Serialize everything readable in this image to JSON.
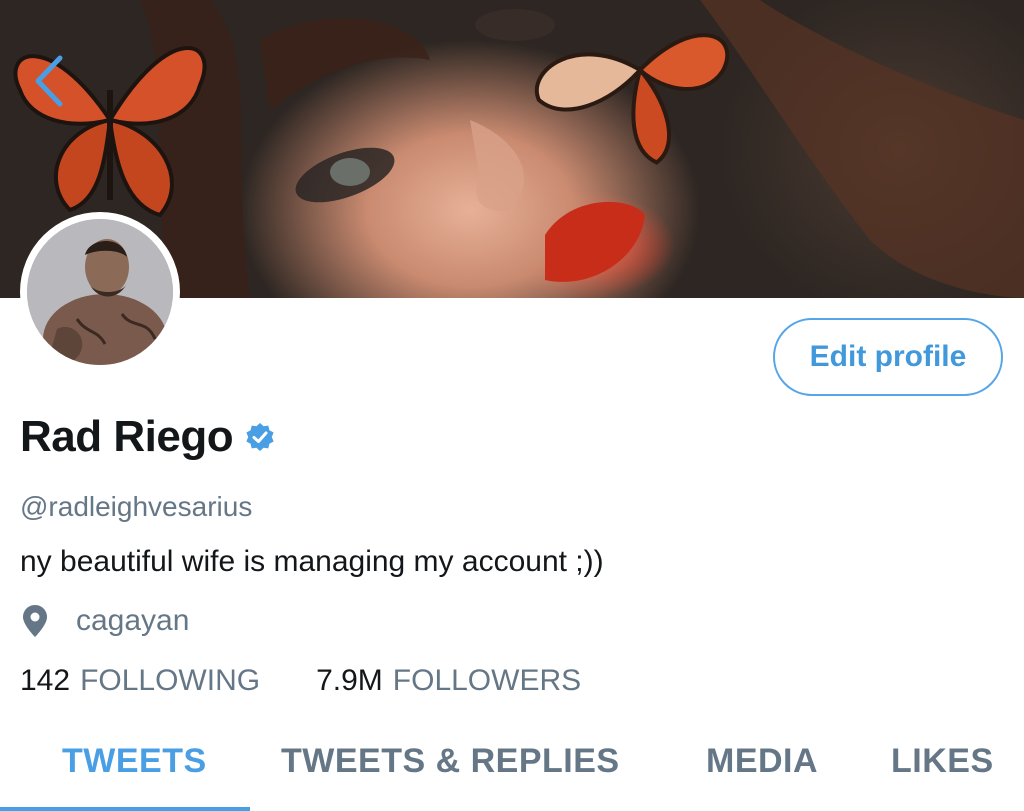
{
  "profile": {
    "display_name": "Rad Riego",
    "handle": "@radleighvesarius",
    "bio": "ny beautiful wife is managing my account ;))",
    "location": "cagayan",
    "verified": true
  },
  "actions": {
    "edit_profile_label": "Edit profile"
  },
  "stats": {
    "following_count": "142",
    "following_label": "FOLLOWING",
    "followers_count": "7.9M",
    "followers_label": "FOLLOWERS"
  },
  "tabs": [
    {
      "label": "TWEETS",
      "active": true
    },
    {
      "label": "TWEETS & REPLIES",
      "active": false
    },
    {
      "label": "MEDIA",
      "active": false
    },
    {
      "label": "LIKES",
      "active": false
    }
  ],
  "icons": {
    "back": "chevron-left-icon",
    "verified": "verified-badge-icon",
    "location": "location-pin-icon"
  },
  "colors": {
    "accent": "#4a9ee4",
    "text_primary": "#14171a",
    "text_secondary": "#657786"
  }
}
